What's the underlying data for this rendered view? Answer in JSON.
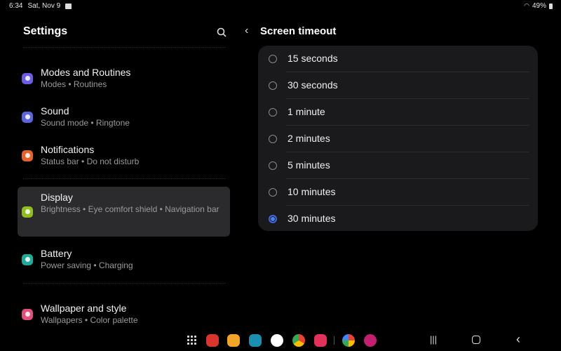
{
  "status_bar": {
    "time": "6:34",
    "date": "Sat, Nov 9",
    "battery": "49%"
  },
  "left": {
    "title": "Settings",
    "items": [
      {
        "title": "Modes and Routines",
        "subtitle": "Modes  •  Routines",
        "icon": "modes-icon",
        "color": "#6a5de0"
      },
      {
        "title": "Sound",
        "subtitle": "Sound mode  •  Ringtone",
        "icon": "sound-icon",
        "color": "#5d65dc"
      },
      {
        "title": "Notifications",
        "subtitle": "Status bar  •  Do not disturb",
        "icon": "notifications-icon",
        "color": "#e2632e"
      },
      {
        "title": "Display",
        "subtitle": "Brightness  •  Eye comfort shield  •  Navigation bar",
        "icon": "display-icon",
        "color": "#8fbf1f",
        "selected": true
      },
      {
        "title": "Battery",
        "subtitle": "Power saving  •  Charging",
        "icon": "battery-icon",
        "color": "#21a99a"
      },
      {
        "title": "Wallpaper and style",
        "subtitle": "Wallpapers  •  Color palette",
        "icon": "wallpaper-icon",
        "color": "#e0507a"
      }
    ]
  },
  "right": {
    "title": "Screen timeout",
    "options": [
      {
        "label": "15 seconds",
        "selected": false
      },
      {
        "label": "30 seconds",
        "selected": false
      },
      {
        "label": "1 minute",
        "selected": false
      },
      {
        "label": "2 minutes",
        "selected": false
      },
      {
        "label": "5 minutes",
        "selected": false
      },
      {
        "label": "10 minutes",
        "selected": false
      },
      {
        "label": "30 minutes",
        "selected": true
      }
    ]
  },
  "taskbar": {
    "apps": [
      {
        "name": "notes-app-icon",
        "color": "#d8352f"
      },
      {
        "name": "files-app-icon",
        "color": "#f0a52a"
      },
      {
        "name": "calendar-app-icon",
        "color": "#1c8fb0"
      },
      {
        "name": "messages-app-icon",
        "color": "#ffffff"
      },
      {
        "name": "chrome-app-icon",
        "color": "#e8e8e8"
      },
      {
        "name": "screen-recorder-app-icon",
        "color": "#e2325a"
      },
      {
        "name": "photos-app-icon",
        "color": "#f2f2f2"
      },
      {
        "name": "flower-app-icon",
        "color": "#c2206f"
      }
    ]
  }
}
